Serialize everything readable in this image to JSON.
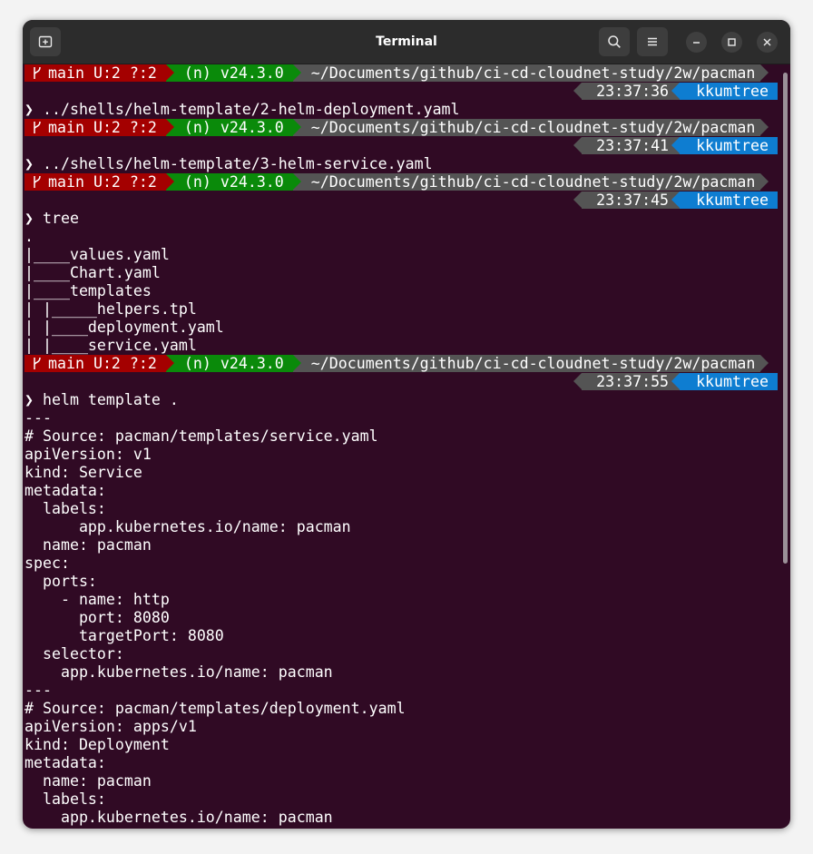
{
  "window": {
    "title": "Terminal"
  },
  "prompt": {
    "git": "main U:2 ?:2",
    "node": "(n) v24.3.0",
    "path": "~/Documents/github/ci-cd-cloudnet-study/2w/pacman",
    "user": "kkumtree",
    "prompt_char": "❯"
  },
  "blocks": [
    {
      "time": "23:37:36",
      "command": "../shells/helm-template/2-helm-deployment.yaml",
      "output": []
    },
    {
      "time": "23:37:41",
      "command": "../shells/helm-template/3-helm-service.yaml",
      "output": []
    },
    {
      "time": "23:37:45",
      "command": "tree",
      "output": [
        ".",
        "|____values.yaml",
        "|____Chart.yaml",
        "|____templates",
        "| |_____helpers.tpl",
        "| |____deployment.yaml",
        "| |____service.yaml"
      ]
    },
    {
      "time": "23:37:55",
      "command": "helm template .",
      "output": [
        "---",
        "# Source: pacman/templates/service.yaml",
        "apiVersion: v1",
        "kind: Service",
        "metadata:",
        "  labels:",
        "      app.kubernetes.io/name: pacman",
        "  name: pacman",
        "spec:",
        "  ports:",
        "    - name: http",
        "      port: 8080",
        "      targetPort: 8080",
        "  selector:",
        "    app.kubernetes.io/name: pacman",
        "---",
        "# Source: pacman/templates/deployment.yaml",
        "apiVersion: apps/v1",
        "kind: Deployment",
        "metadata:",
        "  name: pacman",
        "  labels:",
        "    app.kubernetes.io/name: pacman"
      ]
    }
  ],
  "colors": {
    "background": "#300a24",
    "git_segment": "#a40000",
    "node_segment": "#0a8a0a",
    "path_segment": "#545454",
    "user_segment": "#0e7dd1"
  },
  "icons": {
    "new_tab": "new-tab-icon",
    "search": "search-icon",
    "menu": "hamburger-menu-icon",
    "minimize": "minimize-icon",
    "maximize": "maximize-icon",
    "close": "close-icon",
    "branch": "git-branch-icon"
  }
}
